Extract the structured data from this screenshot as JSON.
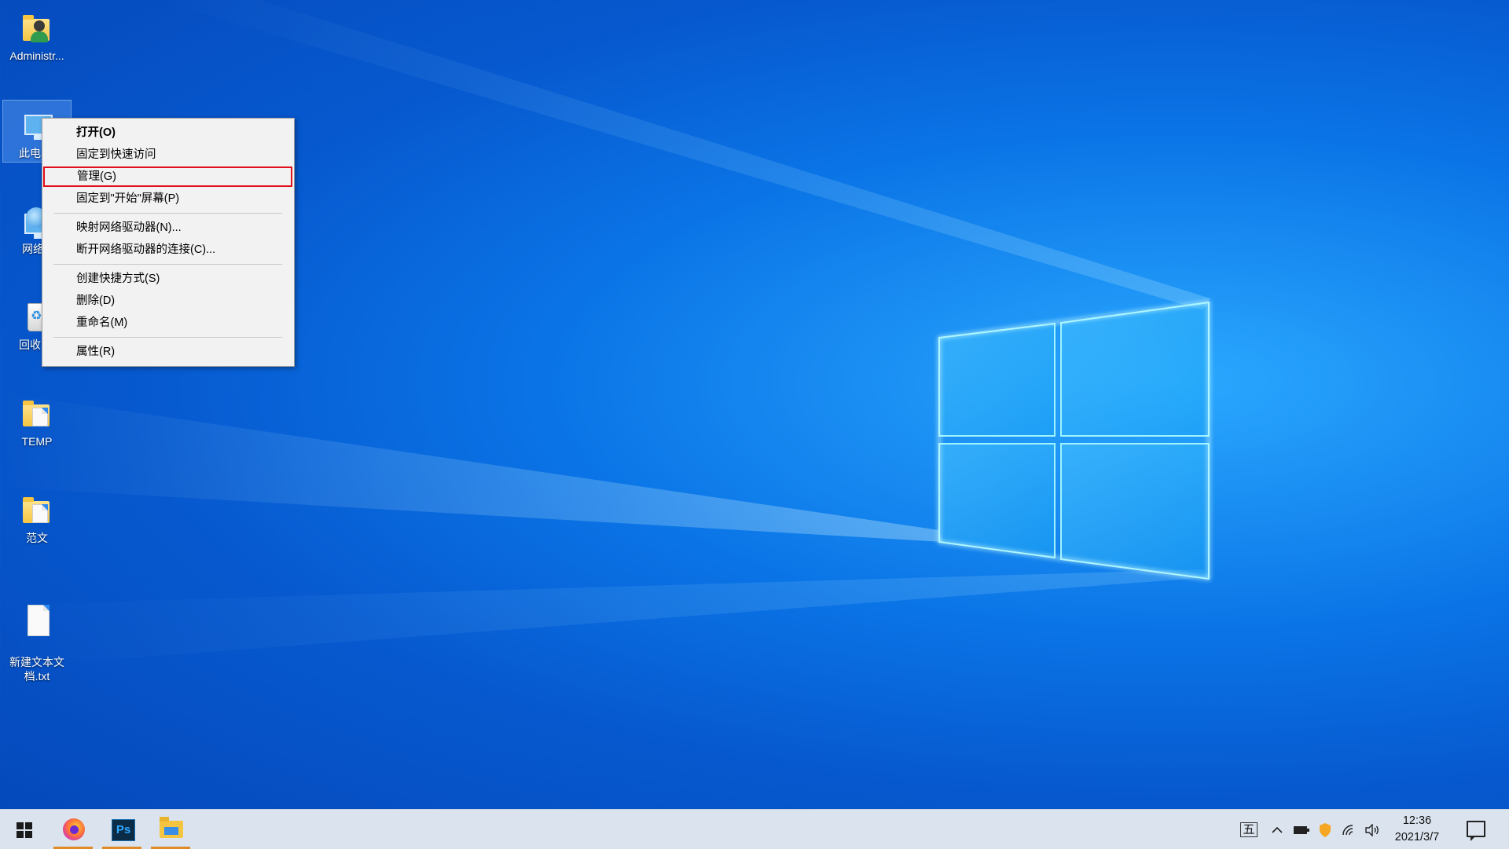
{
  "desktop": {
    "icons": [
      {
        "label": "Administr...",
        "icon": "user-folder-icon"
      },
      {
        "label": "此电",
        "icon": "this-pc-icon"
      },
      {
        "label": "网络",
        "icon": "network-icon"
      },
      {
        "label": "回收",
        "icon": "recycle-bin-icon"
      },
      {
        "label": "TEMP",
        "icon": "folder-icon"
      },
      {
        "label": "范文",
        "icon": "folder-icon"
      },
      {
        "label": "新建文本文\n档.txt",
        "icon": "text-file-icon"
      }
    ]
  },
  "context_menu": {
    "items": [
      {
        "label": "打开(O)",
        "bold": true
      },
      {
        "label": "固定到快速访问"
      },
      {
        "label": "管理(G)",
        "highlighted": true
      },
      {
        "label": "固定到\"开始\"屏幕(P)"
      },
      {
        "label": "映射网络驱动器(N)..."
      },
      {
        "label": "断开网络驱动器的连接(C)..."
      },
      {
        "label": "创建快捷方式(S)"
      },
      {
        "label": "删除(D)"
      },
      {
        "label": "重命名(M)"
      },
      {
        "label": "属性(R)"
      }
    ],
    "highlight_color": "#e0101a"
  },
  "taskbar": {
    "apps": [
      {
        "name": "start-button",
        "icon": "windows-icon"
      },
      {
        "name": "firefox",
        "icon": "firefox-icon"
      },
      {
        "name": "photoshop",
        "icon": "photoshop-icon",
        "text": "Ps"
      },
      {
        "name": "file-explorer",
        "icon": "folder-icon"
      }
    ],
    "tray": {
      "ime": "五",
      "time": "12:36",
      "date": "2021/3/7"
    },
    "running_indicator_color": "#e08a26"
  }
}
